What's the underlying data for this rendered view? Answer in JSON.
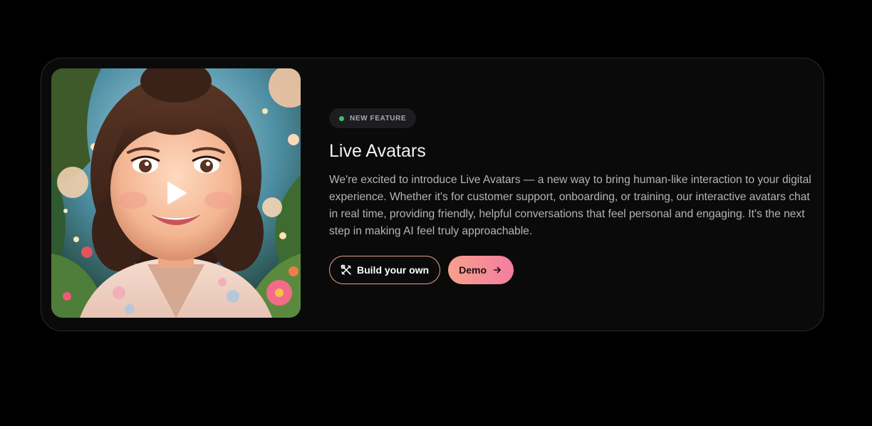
{
  "feature": {
    "badge_label": "NEW FEATURE",
    "badge_color": "#35c26a",
    "title": "Live Avatars",
    "description": "We're excited to introduce Live Avatars — a new way to bring human-like interaction to your digital experience. Whether it's for customer support, onboarding, or training, our interactive avatars chat in real time, providing friendly, helpful conversations that feel personal and engaging. It's the next step in making AI feel truly approachable."
  },
  "media": {
    "play_icon": "play-icon"
  },
  "actions": {
    "build_label": "Build your own",
    "build_icon": "tools-icon",
    "demo_label": "Demo",
    "demo_icon": "arrow-right-icon",
    "accent_start": "#f7a08b",
    "accent_end": "#f57da0"
  }
}
